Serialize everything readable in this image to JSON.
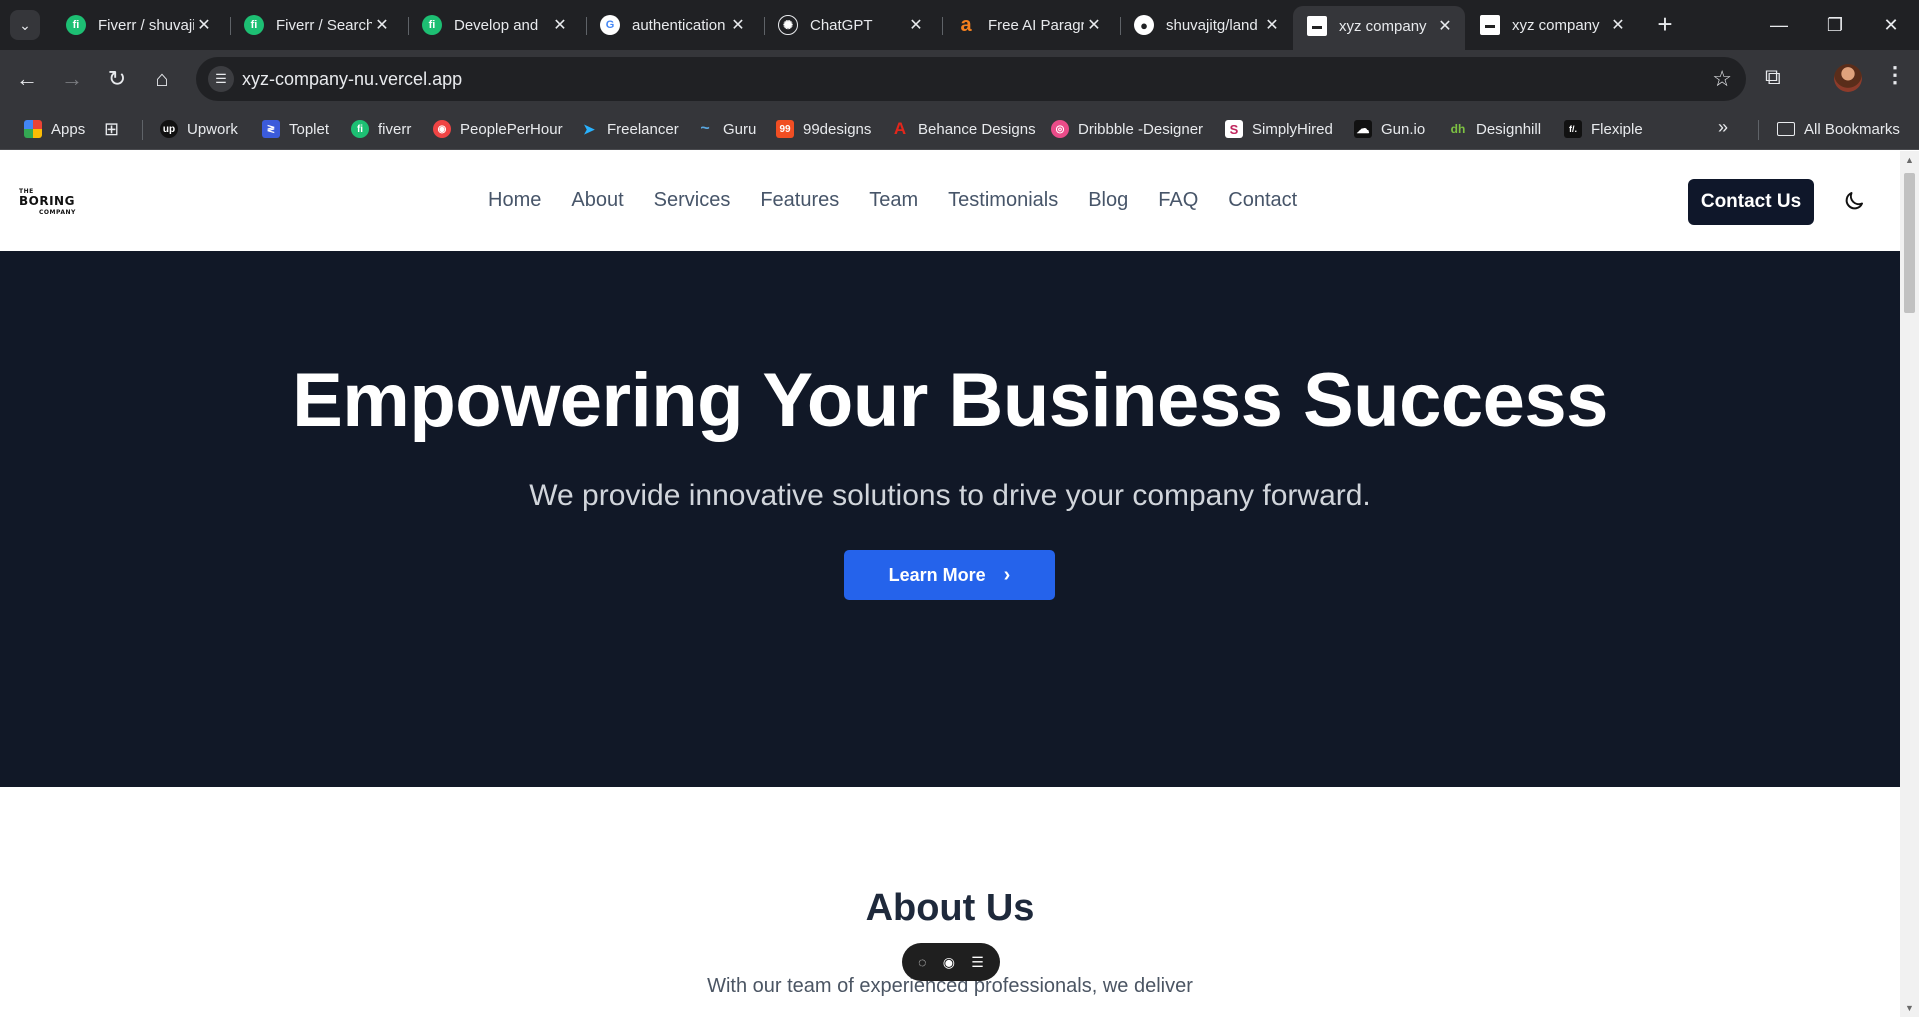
{
  "tabs": [
    {
      "title": "Fiverr / shuvajitg",
      "icon": "fiverr-icon",
      "color": "#1dbf73",
      "glyph": "fi"
    },
    {
      "title": "Fiverr / Search",
      "icon": "fiverr-icon",
      "color": "#1dbf73",
      "glyph": "fi"
    },
    {
      "title": "Develop and",
      "icon": "fiverr-icon",
      "color": "#1dbf73",
      "glyph": "fi"
    },
    {
      "title": "authentication",
      "icon": "google-icon",
      "color": "#ffffff",
      "glyph": "G"
    },
    {
      "title": "ChatGPT",
      "icon": "chatgpt-icon",
      "color": "#202124",
      "glyph": "✺"
    },
    {
      "title": "Free AI Paragraph",
      "icon": "ahrefs-icon",
      "color": "#f4801f",
      "glyph": "a"
    },
    {
      "title": "shuvajitg/land",
      "icon": "github-icon",
      "color": "#ffffff",
      "glyph": "●"
    },
    {
      "title": "xyz company",
      "icon": "site-icon",
      "color": "#ffffff",
      "glyph": "▬"
    },
    {
      "title": "xyz company",
      "icon": "site-icon",
      "color": "#ffffff",
      "glyph": "▬"
    }
  ],
  "address": {
    "url": "xyz-company-nu.vercel.app"
  },
  "bookmarks": {
    "apps": "Apps",
    "items": [
      {
        "label": "Upwork",
        "icon": "upwork-icon",
        "color": "#111111",
        "glyph": "up"
      },
      {
        "label": "Toplet",
        "icon": "toplet-icon",
        "color": "#3b5bdb",
        "glyph": "≷"
      },
      {
        "label": "fiverr",
        "icon": "fiverr-icon",
        "color": "#1dbf73",
        "glyph": "fi"
      },
      {
        "label": "PeoplePerHour",
        "icon": "peopleperhour-icon",
        "color": "#ef4444",
        "glyph": "◉"
      },
      {
        "label": "Freelancer",
        "icon": "freelancer-icon",
        "color": "#29b2fe",
        "glyph": "➤"
      },
      {
        "label": "Guru",
        "icon": "guru-icon",
        "color": "#35363a",
        "glyph": "~"
      },
      {
        "label": "99designs",
        "icon": "99designs-icon",
        "color": "#f04e23",
        "glyph": "99"
      },
      {
        "label": "Behance Designs",
        "icon": "adobe-icon",
        "color": "#e3261b",
        "glyph": "A"
      },
      {
        "label": "Dribbble -Designer",
        "icon": "dribbble-icon",
        "color": "#ea4c89",
        "glyph": "◎"
      },
      {
        "label": "SimplyHired",
        "icon": "simplyhired-icon",
        "color": "#ffffff",
        "glyph": "S"
      },
      {
        "label": "Gun.io",
        "icon": "gunio-icon",
        "color": "#111111",
        "glyph": "☁"
      },
      {
        "label": "Designhill",
        "icon": "designhill-icon",
        "color": "#35363a",
        "glyph": "dh"
      },
      {
        "label": "Flexiple",
        "icon": "flexiple-icon",
        "color": "#111111",
        "glyph": "f/."
      }
    ],
    "all": "All Bookmarks"
  },
  "site": {
    "logo": {
      "the": "THE",
      "main": "BORING",
      "sub": "COMPANY"
    },
    "nav": [
      "Home",
      "About",
      "Services",
      "Features",
      "Team",
      "Testimonials",
      "Blog",
      "FAQ",
      "Contact"
    ],
    "cta": "Contact Us",
    "hero": {
      "title": "Empowering Your Business Success",
      "subtitle": "We provide innovative solutions to drive your company forward.",
      "button": "Learn More"
    },
    "about": {
      "title": "About Us",
      "text": "With our team of experienced professionals, we deliver"
    }
  },
  "colors": {
    "hero_bg": "#111827",
    "primary": "#2563eb",
    "dark_button": "#0f172a",
    "chrome_bg": "#202124"
  }
}
